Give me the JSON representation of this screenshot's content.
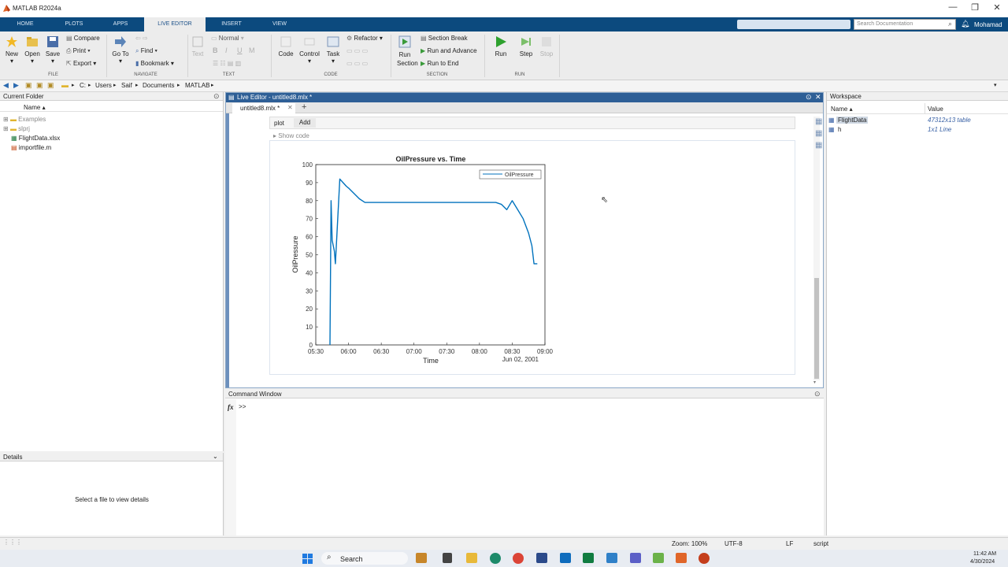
{
  "app": {
    "title": "MATLAB R2024a"
  },
  "tabs": [
    "HOME",
    "PLOTS",
    "APPS",
    "LIVE EDITOR",
    "INSERT",
    "VIEW"
  ],
  "search": {
    "placeholder": "Search Documentation"
  },
  "user": {
    "name": "Mohamad"
  },
  "ribbon": {
    "file": {
      "new": "New",
      "open": "Open",
      "save": "Save",
      "compare": "Compare",
      "print": "Print",
      "export": "Export",
      "group": "FILE"
    },
    "navigate": {
      "goto": "Go To",
      "find": "Find",
      "bookmark": "Bookmark",
      "group": "NAVIGATE"
    },
    "text": {
      "text": "Text",
      "style": "Normal",
      "bold": "B",
      "italic": "I",
      "underline": "U",
      "mono": "M",
      "group": "TEXT"
    },
    "code": {
      "code": "Code",
      "control": "Control",
      "task": "Task",
      "refactor": "Refactor",
      "group": "CODE"
    },
    "section": {
      "run_section": "Run Section",
      "section_break": "Section Break",
      "run_advance": "Run and Advance",
      "run_end": "Run to End",
      "group": "SECTION"
    },
    "run": {
      "run": "Run",
      "step": "Step",
      "stop": "Stop",
      "group": "RUN"
    }
  },
  "address": {
    "parts": [
      "C:",
      "Users",
      "Saif",
      "Documents",
      "MATLAB"
    ]
  },
  "current_folder": {
    "title": "Current Folder",
    "col_name": "Name ▴",
    "items": [
      "Examples",
      "slprj",
      "FlightData.xlsx",
      "importfile.m"
    ]
  },
  "details": {
    "title": "Details",
    "empty": "Select a file to view details"
  },
  "editor": {
    "window_title": "Live Editor - untitled8.mlx *",
    "tab": "untitled8.mlx *",
    "plot_label": "plot",
    "add_label": "Add",
    "show_code": "Show code"
  },
  "command_window": {
    "title": "Command Window",
    "fx": "fx",
    "prompt": ">>"
  },
  "workspace": {
    "title": "Workspace",
    "col_name": "Name ▴",
    "col_value": "Value",
    "vars": [
      {
        "name": "FlightData",
        "value": "47312x13 table"
      },
      {
        "name": "h",
        "value": "1x1 Line"
      }
    ]
  },
  "status": {
    "zoom": "Zoom: 100%",
    "encoding": "UTF-8",
    "eol": "LF",
    "type": "script"
  },
  "taskbar": {
    "search": "Search",
    "time": "11:42 AM",
    "date": "4/30/2024"
  },
  "chart_data": {
    "type": "line",
    "title": "OilPressure vs. Time",
    "xlabel": "Time",
    "ylabel": "OilPressure",
    "x_ticks": [
      "05:30",
      "06:00",
      "06:30",
      "07:00",
      "07:30",
      "08:00",
      "08:30",
      "09:00"
    ],
    "x_secondary": "Jun 02, 2001",
    "y_ticks": [
      "0",
      "10",
      "20",
      "30",
      "40",
      "50",
      "60",
      "70",
      "80",
      "90",
      "100"
    ],
    "ylim": [
      0,
      100
    ],
    "xlim": [
      "05:30",
      "09:00"
    ],
    "legend": {
      "label": "OilPressure",
      "position": "top-right"
    },
    "series": [
      {
        "name": "OilPressure",
        "color": "#0072bd",
        "x": [
          "05:43",
          "05:44",
          "05:45",
          "05:46",
          "05:47",
          "05:48",
          "05:52",
          "05:55",
          "05:58",
          "06:00",
          "06:05",
          "06:10",
          "06:15",
          "06:20",
          "06:30",
          "06:45",
          "07:00",
          "07:15",
          "07:30",
          "07:45",
          "08:00",
          "08:10",
          "08:15",
          "08:20",
          "08:25",
          "08:30",
          "08:35",
          "08:40",
          "08:45",
          "08:48",
          "08:50",
          "08:53"
        ],
        "y": [
          0,
          80,
          58,
          55,
          52,
          45,
          92,
          90,
          88,
          87,
          84,
          81,
          79,
          79,
          79,
          79,
          79,
          79,
          79,
          79,
          79,
          79,
          79,
          78,
          75,
          80,
          75,
          70,
          62,
          55,
          45,
          45
        ]
      }
    ]
  }
}
